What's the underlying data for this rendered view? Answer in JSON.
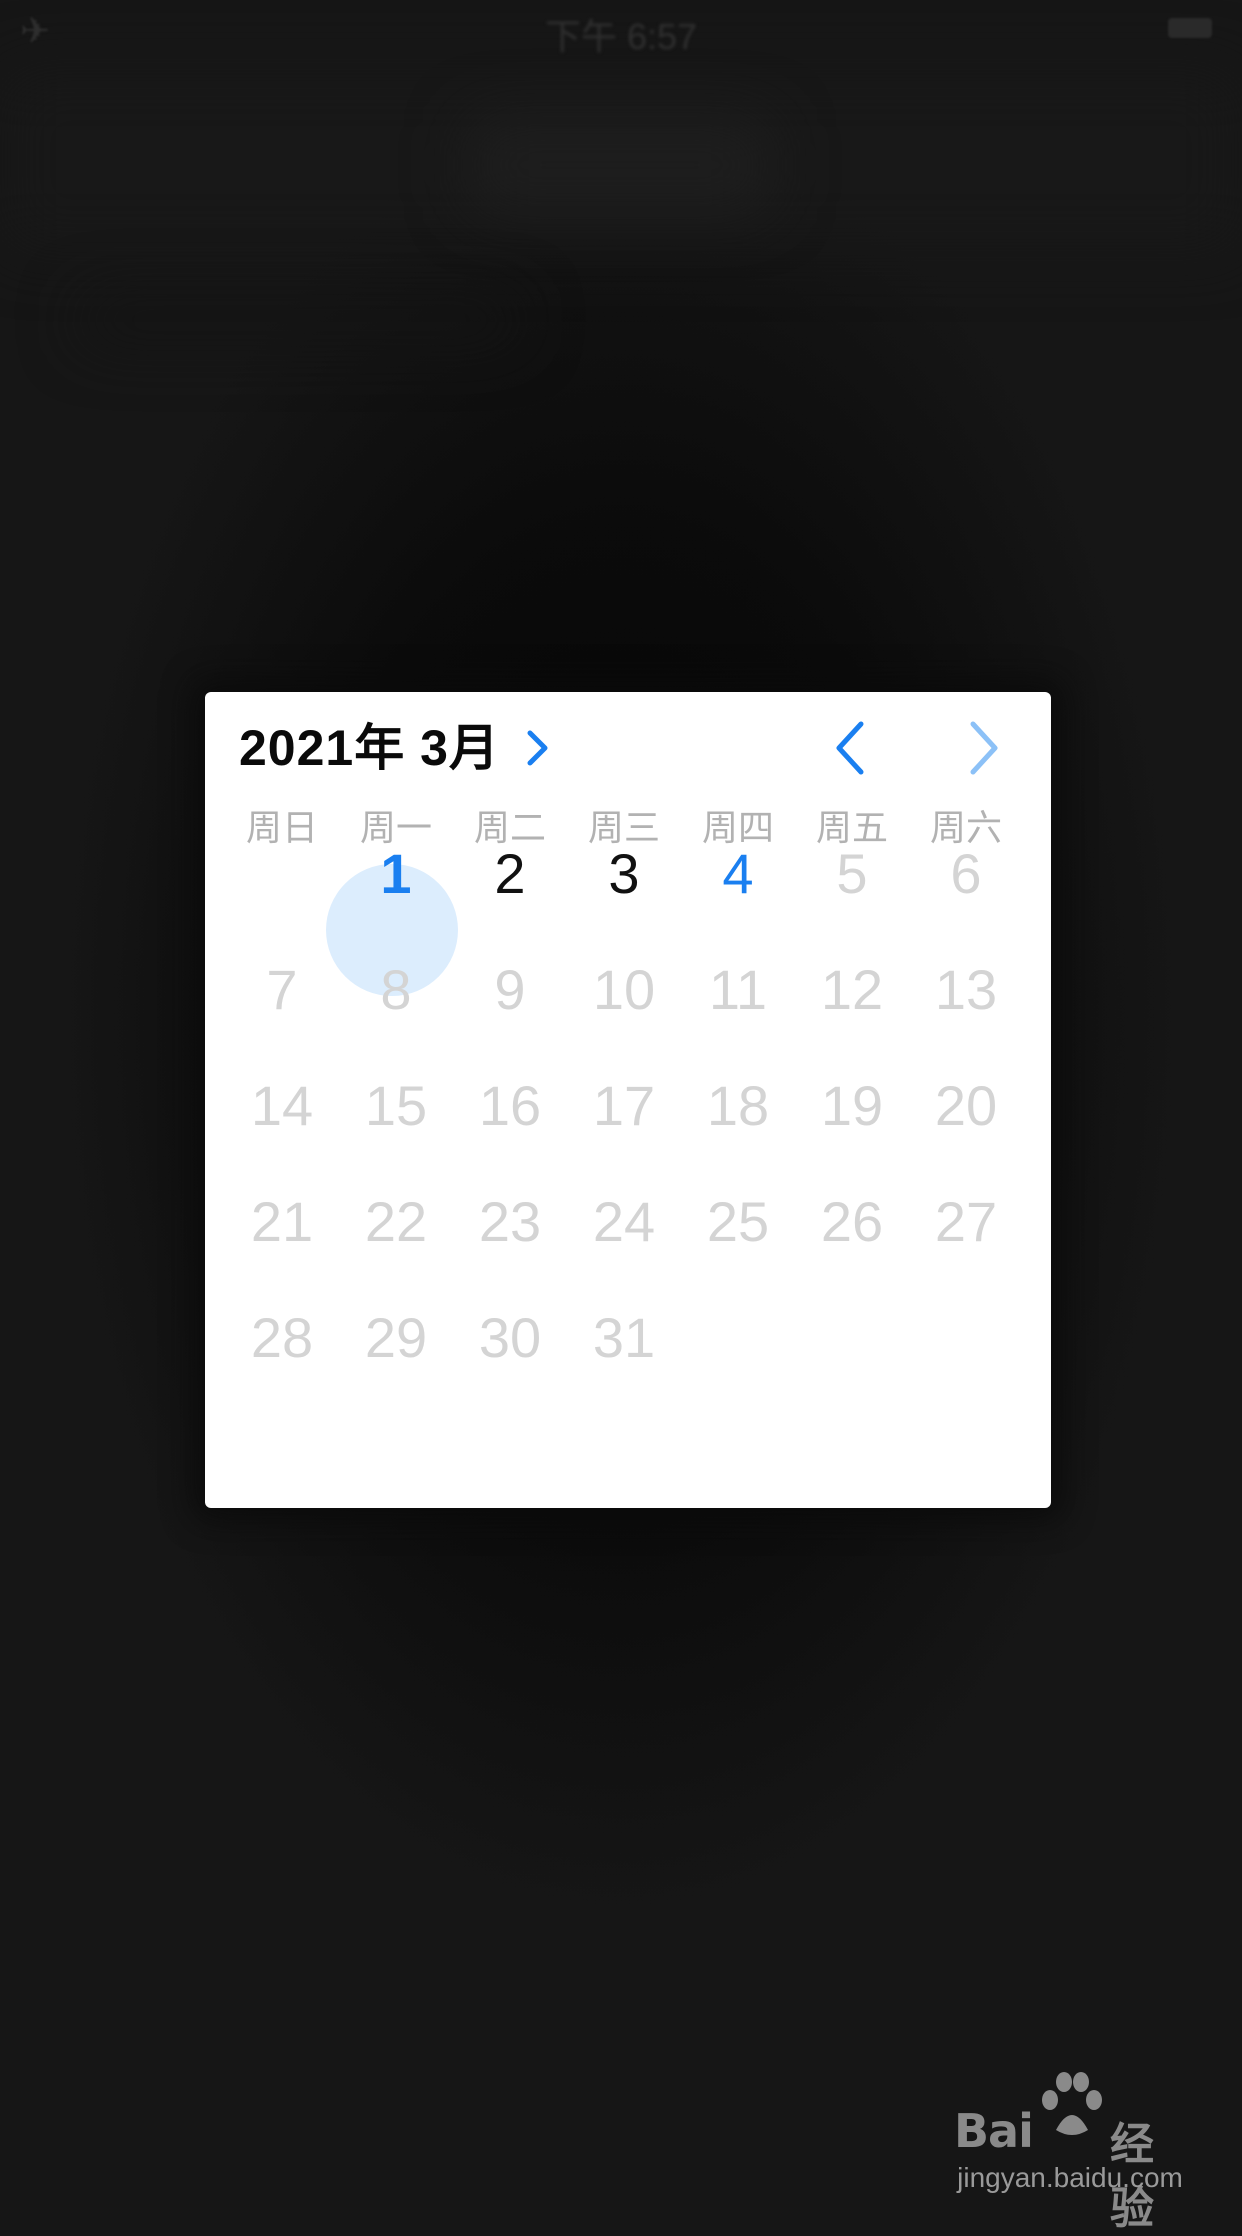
{
  "status_bar": {
    "time": "下午 6:57"
  },
  "calendar": {
    "month_title": "2021年 3月",
    "weekdays": [
      "周日",
      "周一",
      "周二",
      "周三",
      "周四",
      "周五",
      "周六"
    ],
    "days": [
      "1",
      "2",
      "3",
      "4",
      "5",
      "6",
      "7",
      "8",
      "9",
      "10",
      "11",
      "12",
      "13",
      "14",
      "15",
      "16",
      "17",
      "18",
      "19",
      "20",
      "21",
      "22",
      "23",
      "24",
      "25",
      "26",
      "27",
      "28",
      "29",
      "30",
      "31"
    ],
    "selected_day": "1",
    "today": "4",
    "colors": {
      "accent": "#1a7ff0",
      "selected_bg": "#dcedfd",
      "disabled_day": "#d4d4d4",
      "weekday_label": "#b2b2b2"
    }
  },
  "watermark": {
    "brand": "Bai",
    "brand_cn": "经验",
    "url": "jingyan.baidu.com"
  }
}
